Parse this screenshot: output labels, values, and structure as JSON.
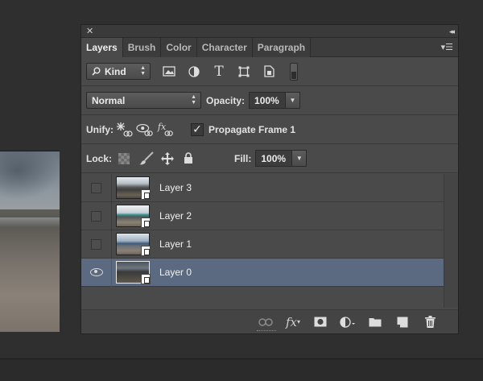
{
  "panel": {
    "close_glyph": "✕",
    "collapse_glyph": "◂◂",
    "menu_glyph": "▾☰"
  },
  "tabs": [
    {
      "label": "Layers",
      "active": true
    },
    {
      "label": "Brush",
      "active": false
    },
    {
      "label": "Color",
      "active": false
    },
    {
      "label": "Character",
      "active": false
    },
    {
      "label": "Paragraph",
      "active": false
    }
  ],
  "filter": {
    "kind_label": "Kind",
    "search_icon": "search-icon",
    "icons": [
      "image-filter-icon",
      "adjustment-filter-icon",
      "type-filter-icon",
      "shape-filter-icon",
      "smart-object-filter-icon",
      "filter-toggle-icon"
    ]
  },
  "blend": {
    "mode": "Normal",
    "opacity_label": "Opacity:",
    "opacity_value": "100%"
  },
  "unify": {
    "label": "Unify:",
    "propagate_label": "Propagate Frame 1",
    "propagate_checked": true,
    "check_glyph": "✓"
  },
  "lock": {
    "label": "Lock:",
    "fill_label": "Fill:",
    "fill_value": "100%"
  },
  "layers": [
    {
      "name": "Layer 3",
      "visible": false,
      "selected": false
    },
    {
      "name": "Layer 2",
      "visible": false,
      "selected": false
    },
    {
      "name": "Layer 1",
      "visible": false,
      "selected": false
    },
    {
      "name": "Layer 0",
      "visible": true,
      "selected": true
    }
  ],
  "footer_icons": [
    "link-icon",
    "fx-icon",
    "mask-icon",
    "adjustment-layer-icon",
    "folder-icon",
    "new-layer-icon",
    "trash-icon"
  ],
  "footer": {
    "fx_label": "fx"
  },
  "colors": {
    "panel_bg": "#4a4a4a",
    "selected_row": "#5b6a80",
    "app_bg": "#2f2f2f"
  }
}
